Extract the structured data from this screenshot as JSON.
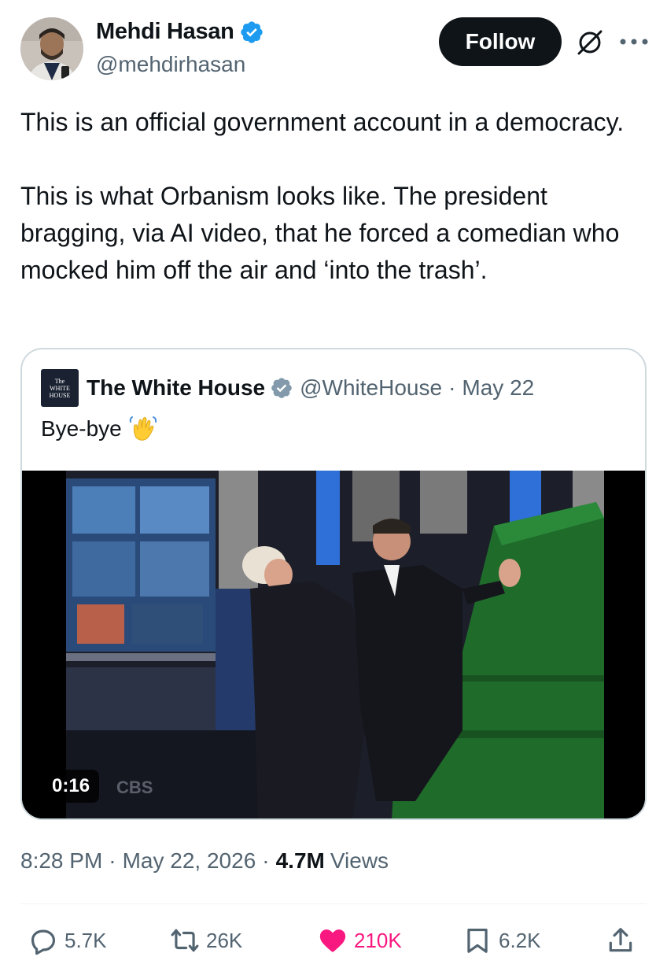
{
  "author": {
    "name": "Mehdi Hasan",
    "handle": "@mehdirhasan",
    "follow_label": "Follow"
  },
  "tweet": {
    "text": "This is an official government account in a democracy.\n\nThis is what Orbanism looks like. The president bragging, via AI video, that he forced a comedian who mocked him off the air and ‘into the trash’."
  },
  "quoted": {
    "logo_lines": [
      "The",
      "WHITE",
      "HOUSE"
    ],
    "name": "The White House",
    "handle": "@WhiteHouse",
    "separator": "·",
    "date": "May 22",
    "text": "Bye-bye",
    "emoji": "waving-hand",
    "video_duration": "0:16",
    "video_watermark": "CBS"
  },
  "meta": {
    "time": "8:28 PM",
    "separator": "·",
    "date": "May 22, 2026",
    "views_count": "4.7M",
    "views_label": "Views"
  },
  "actions": {
    "replies": "5.7K",
    "reposts": "26K",
    "likes": "210K",
    "bookmarks": "6.2K"
  },
  "colors": {
    "verified": "#1d9bf0",
    "like": "#f91880",
    "secondary_text": "#536471",
    "border": "#cfd9de",
    "dumpster_green": "#1f6b2a"
  }
}
